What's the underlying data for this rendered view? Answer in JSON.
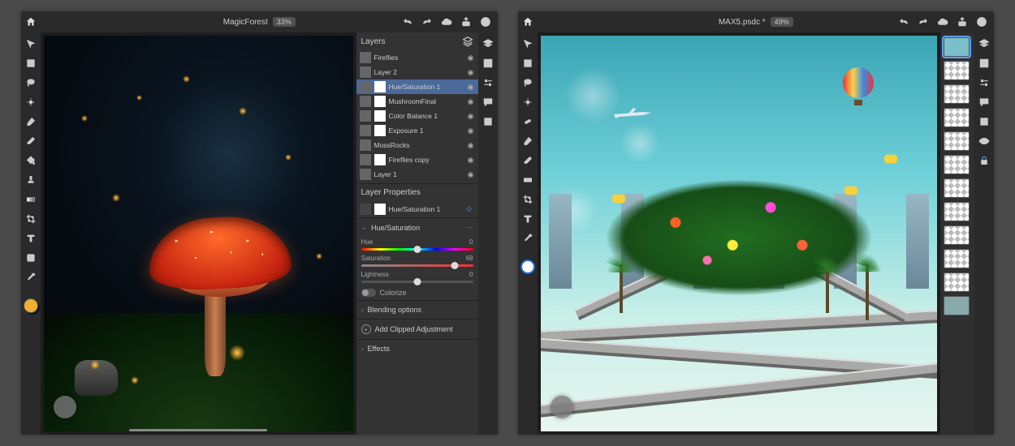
{
  "app1": {
    "title": "MagicForest",
    "zoom": "33%",
    "tools": [
      "move",
      "transform",
      "lasso",
      "select",
      "brush",
      "erase",
      "fill",
      "clone",
      "gradient",
      "crop",
      "type",
      "shape",
      "eyedropper"
    ],
    "color_chip": "#f0b030",
    "layers_panel": {
      "title": "Layers",
      "items": [
        {
          "name": "Fireflies",
          "selected": false
        },
        {
          "name": "Layer 2",
          "selected": false
        },
        {
          "name": "Hue/Saturation 1",
          "selected": true,
          "mask": true
        },
        {
          "name": "MushroomFinal",
          "selected": false,
          "mask": true
        },
        {
          "name": "Color Balance 1",
          "selected": false,
          "mask": true
        },
        {
          "name": "Exposure 1",
          "selected": false,
          "mask": true
        },
        {
          "name": "MossRocks",
          "selected": false
        },
        {
          "name": "Fireflies copy",
          "selected": false,
          "mask": true
        },
        {
          "name": "Layer 1",
          "selected": false
        }
      ]
    },
    "layer_properties": {
      "title": "Layer Properties",
      "current": "Hue/Saturation 1",
      "section": "Hue/Saturation",
      "sliders": {
        "hue": {
          "label": "Hue",
          "value": 0,
          "min": -180,
          "max": 180,
          "pos": 50,
          "right": "0"
        },
        "saturation": {
          "label": "Saturation",
          "value": 69,
          "min": -100,
          "max": 100,
          "pos": 84,
          "right": "69"
        },
        "lightness": {
          "label": "Lightness",
          "value": 0,
          "min": -100,
          "max": 100,
          "pos": 50,
          "right": "0"
        }
      },
      "colorize_label": "Colorize",
      "blending_label": "Blending options",
      "add_clipped_label": "Add Clipped Adjustment",
      "effects_label": "Effects"
    }
  },
  "app2": {
    "title": "MAX5.psdc *",
    "zoom": "49%",
    "tools": [
      "move",
      "transform",
      "lasso",
      "select",
      "brush",
      "erase",
      "fill",
      "clone",
      "gradient",
      "crop",
      "type",
      "shape",
      "eyedropper"
    ],
    "color_chip_inner": "#ffffff",
    "color_chip_ring": "#1a6adf",
    "thumb_count": 12,
    "selected_thumb": 0
  }
}
